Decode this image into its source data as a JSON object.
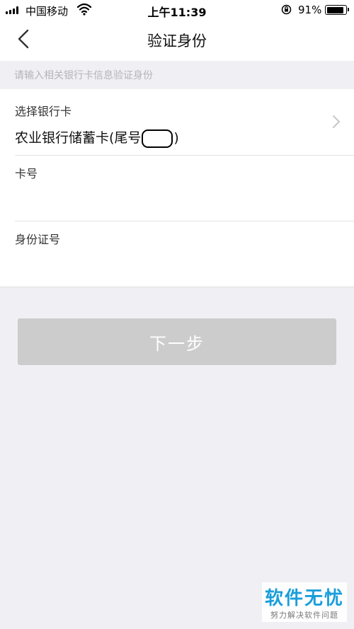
{
  "status_bar": {
    "carrier": "中国移动",
    "time": "上午11:39",
    "battery_percent": "91%",
    "battery_level": 0.91,
    "icons": [
      "signal-icon",
      "wifi-icon",
      "rotation-lock-icon",
      "battery-icon"
    ]
  },
  "nav": {
    "title": "验证身份",
    "back_icon": "chevron-left-icon"
  },
  "hint": "请输入相关银行卡信息验证身份",
  "form": {
    "bank_card": {
      "label": "选择银行卡",
      "value_prefix": "农业银行储蓄卡(尾号",
      "value_suffix": ")",
      "chevron_icon": "chevron-right-icon"
    },
    "card_number": {
      "label": "卡号",
      "value": ""
    },
    "id_number": {
      "label": "身份证号",
      "value": ""
    }
  },
  "next_button": "下一步",
  "watermark": {
    "title": "软件无忧",
    "subtitle": "努力解决软件问题"
  },
  "colors": {
    "background": "#efeff4",
    "button_disabled": "#cccccc",
    "watermark_blue": "#1a9edb"
  }
}
